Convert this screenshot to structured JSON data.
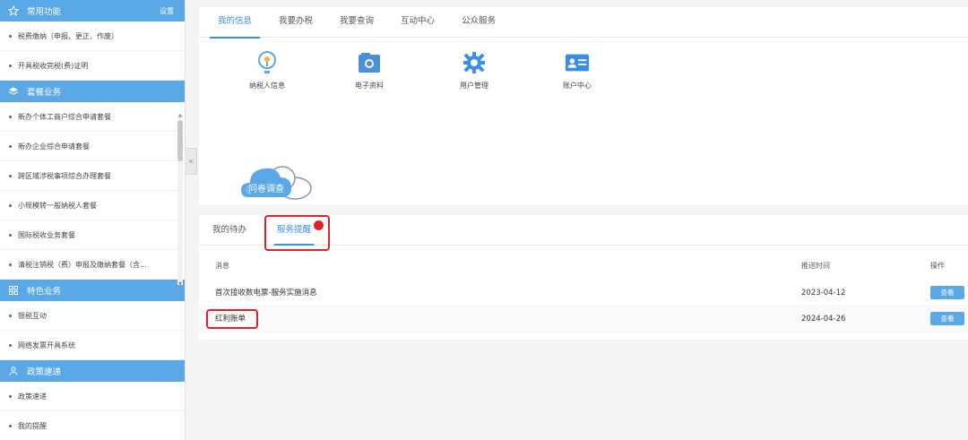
{
  "sidebar": {
    "common": {
      "title": "常用功能",
      "settings": "设置",
      "items": [
        "税费缴纳（申报、更正、作废）",
        "开具税收完税(费)证明"
      ]
    },
    "package": {
      "title": "套餐业务",
      "items": [
        "新办个体工商户综合申请套餐",
        "新办企业综合申请套餐",
        "跨区域涉税事项综合办理套餐",
        "小规模转一般纳税人套餐",
        "国际税收业务套餐",
        "清税注销税（费）申报及缴纳套餐（含..."
      ]
    },
    "special": {
      "title": "特色业务",
      "items": [
        "银税互动",
        "网络发票开具系统"
      ]
    },
    "policy": {
      "title": "政策速递",
      "items": [
        "政策速递",
        "我的提醒"
      ]
    }
  },
  "top": {
    "tabs": [
      "我的信息",
      "我要办税",
      "我要查询",
      "互动中心",
      "公众服务"
    ],
    "shortcuts": [
      {
        "label": "纳税人信息",
        "icon": "taxpayer-info-icon"
      },
      {
        "label": "电子资料",
        "icon": "electronic-docs-icon"
      },
      {
        "label": "用户管理",
        "icon": "user-management-icon"
      },
      {
        "label": "账户中心",
        "icon": "account-center-icon"
      }
    ],
    "survey": "问卷调查"
  },
  "bottom": {
    "tabs": [
      "我的待办",
      "服务提醒"
    ],
    "headers": {
      "message": "消息",
      "time": "推送时间",
      "op": "操作"
    },
    "rows": [
      {
        "message": "首次接收数电票-服务实施消息",
        "time": "2023-04-12",
        "op": "查看"
      },
      {
        "message": "红利账单",
        "time": "2024-04-26",
        "op": "查看"
      }
    ]
  },
  "colors": {
    "accent": "#3a8ee6",
    "header": "#5aa9e6",
    "highlight": "#e0232a"
  }
}
